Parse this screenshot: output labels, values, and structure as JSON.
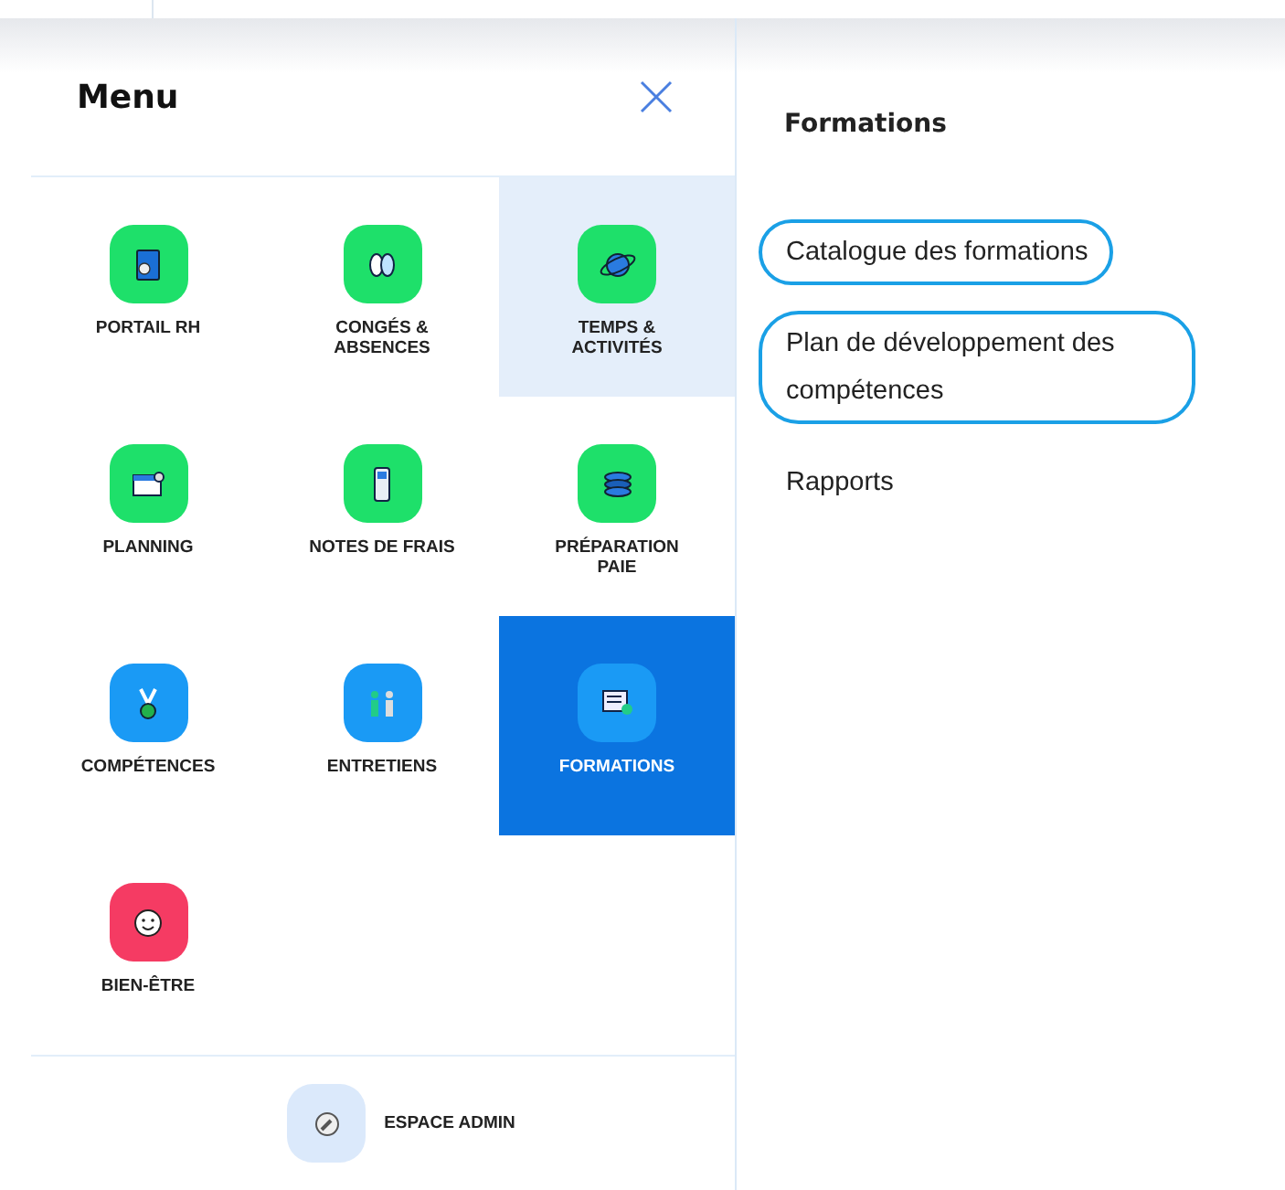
{
  "menu": {
    "title": "Menu",
    "items": [
      {
        "label": "PORTAIL RH",
        "color": "#1ee06a",
        "selected": false,
        "highlighted": false
      },
      {
        "label": "CONGÉS & ABSENCES",
        "color": "#1ee06a",
        "selected": false,
        "highlighted": false
      },
      {
        "label": "TEMPS & ACTIVITÉS",
        "color": "#1ee06a",
        "selected": false,
        "highlighted": true
      },
      {
        "label": "PLANNING",
        "color": "#1ee06a",
        "selected": false,
        "highlighted": false
      },
      {
        "label": "NOTES DE FRAIS",
        "color": "#1ee06a",
        "selected": false,
        "highlighted": false
      },
      {
        "label": "PRÉPARATION PAIE",
        "color": "#1ee06a",
        "selected": false,
        "highlighted": false
      },
      {
        "label": "COMPÉTENCES",
        "color": "#1a9af5",
        "selected": false,
        "highlighted": false
      },
      {
        "label": "ENTRETIENS",
        "color": "#1a9af5",
        "selected": false,
        "highlighted": false
      },
      {
        "label": "FORMATIONS",
        "color": "#1a9af5",
        "selected": true,
        "highlighted": false
      },
      {
        "label": "BIEN-ÊTRE",
        "color": "#f53b63",
        "selected": false,
        "highlighted": false
      }
    ],
    "admin": {
      "label": "ESPACE ADMIN"
    }
  },
  "submenu": {
    "title": "Formations",
    "items": [
      {
        "label": "Catalogue des formations",
        "circled": true
      },
      {
        "label": "Plan de développement des compétences",
        "circled": true
      },
      {
        "label": "Rapports",
        "circled": false
      }
    ]
  }
}
